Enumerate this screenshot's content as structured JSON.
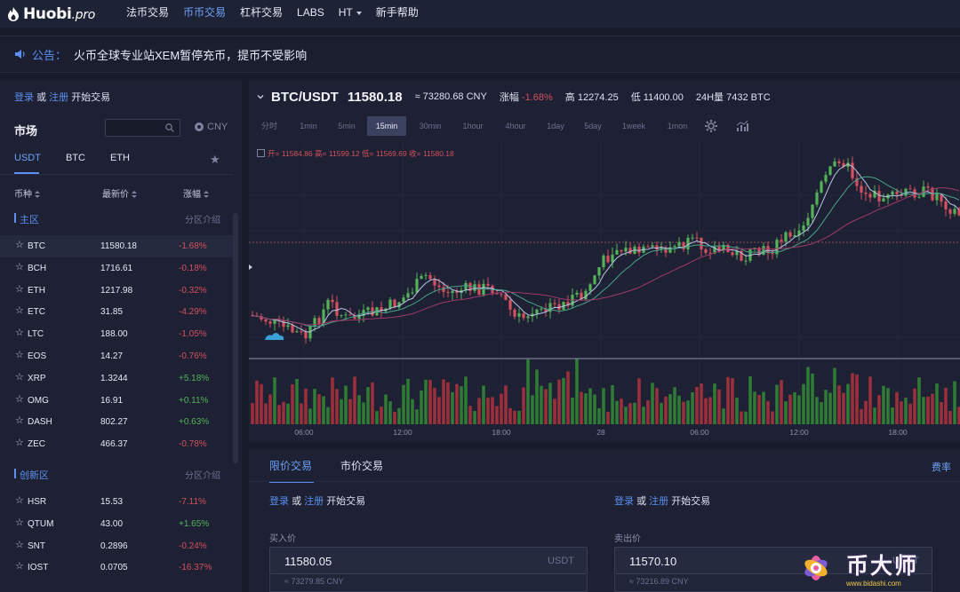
{
  "nav": {
    "logo": "Huobi",
    "logo_suffix": ".pro",
    "items": [
      "法币交易",
      "币币交易",
      "杠杆交易",
      "LABS",
      "HT",
      "新手帮助"
    ],
    "active_index": 1
  },
  "announcement": {
    "label": "公告：",
    "message": "火币全球专业站XEM暂停充币，提币不受影响"
  },
  "market": {
    "login": "登录",
    "or": "或",
    "register": "注册",
    "start": "开始交易",
    "title": "市场",
    "currency": "CNY",
    "tabs": [
      "USDT",
      "BTC",
      "ETH"
    ],
    "col_symbol": "币种",
    "col_price": "最新价",
    "col_change": "涨幅",
    "zones": [
      {
        "name": "主区",
        "intro": "分区介绍"
      },
      {
        "name": "创新区",
        "intro": "分区介绍"
      }
    ],
    "main_rows": [
      {
        "sym": "BTC",
        "price": "11580.18",
        "chg": "-1.68%",
        "dir": "dn"
      },
      {
        "sym": "BCH",
        "price": "1716.61",
        "chg": "-0.18%",
        "dir": "dn"
      },
      {
        "sym": "ETH",
        "price": "1217.98",
        "chg": "-0.32%",
        "dir": "dn"
      },
      {
        "sym": "ETC",
        "price": "31.85",
        "chg": "-4.29%",
        "dir": "dn"
      },
      {
        "sym": "LTC",
        "price": "188.00",
        "chg": "-1.05%",
        "dir": "dn"
      },
      {
        "sym": "EOS",
        "price": "14.27",
        "chg": "-0.76%",
        "dir": "dn"
      },
      {
        "sym": "XRP",
        "price": "1.3244",
        "chg": "+5.18%",
        "dir": "up"
      },
      {
        "sym": "OMG",
        "price": "16.91",
        "chg": "+0.11%",
        "dir": "up"
      },
      {
        "sym": "DASH",
        "price": "802.27",
        "chg": "+0.63%",
        "dir": "up"
      },
      {
        "sym": "ZEC",
        "price": "466.37",
        "chg": "-0.78%",
        "dir": "dn"
      }
    ],
    "innov_rows": [
      {
        "sym": "HSR",
        "price": "15.53",
        "chg": "-7.11%",
        "dir": "dn"
      },
      {
        "sym": "QTUM",
        "price": "43.00",
        "chg": "+1.65%",
        "dir": "up"
      },
      {
        "sym": "SNT",
        "price": "0.2896",
        "chg": "-0.24%",
        "dir": "dn"
      },
      {
        "sym": "IOST",
        "price": "0.0705",
        "chg": "-16.37%",
        "dir": "dn"
      }
    ]
  },
  "ticker": {
    "pair": "BTC/USDT",
    "last": "11580.18",
    "cny": "≈ 73280.68 CNY",
    "change_label": "涨幅",
    "change": "-1.68%",
    "high_label": "高",
    "high": "12274.25",
    "low_label": "低",
    "low": "11400.00",
    "vol_label": "24H量",
    "vol": "7432 BTC"
  },
  "intervals": [
    "分时",
    "1min",
    "5min",
    "15min",
    "30min",
    "1hour",
    "4hour",
    "1day",
    "5day",
    "1week",
    "1mon"
  ],
  "active_interval": "15min",
  "ohlc_line": "开= 11584.86 高= 11599.12 低= 11569.69 收= 11580.18",
  "time_axis": [
    "06:00",
    "12:00",
    "18:00",
    "28",
    "06:00",
    "12:00",
    "18:00"
  ],
  "colors": {
    "up": "#54b25a",
    "down": "#d4505f",
    "accent": "#5b8ff0"
  },
  "order": {
    "tabs": [
      "限价交易",
      "市价交易"
    ],
    "fee": "费率",
    "login": "登录",
    "or": "或",
    "register": "注册",
    "start": "开始交易",
    "buy_label": "买入价",
    "buy_price": "11580.05",
    "buy_unit": "USDT",
    "buy_cny": "≈ 73279.85 CNY",
    "sell_label": "卖出价",
    "sell_price": "11570.10",
    "sell_unit": "USDT",
    "sell_cny": "≈ 73216.89 CNY"
  },
  "watermark": {
    "text": "币大师",
    "url": "www.bidashi.com"
  }
}
